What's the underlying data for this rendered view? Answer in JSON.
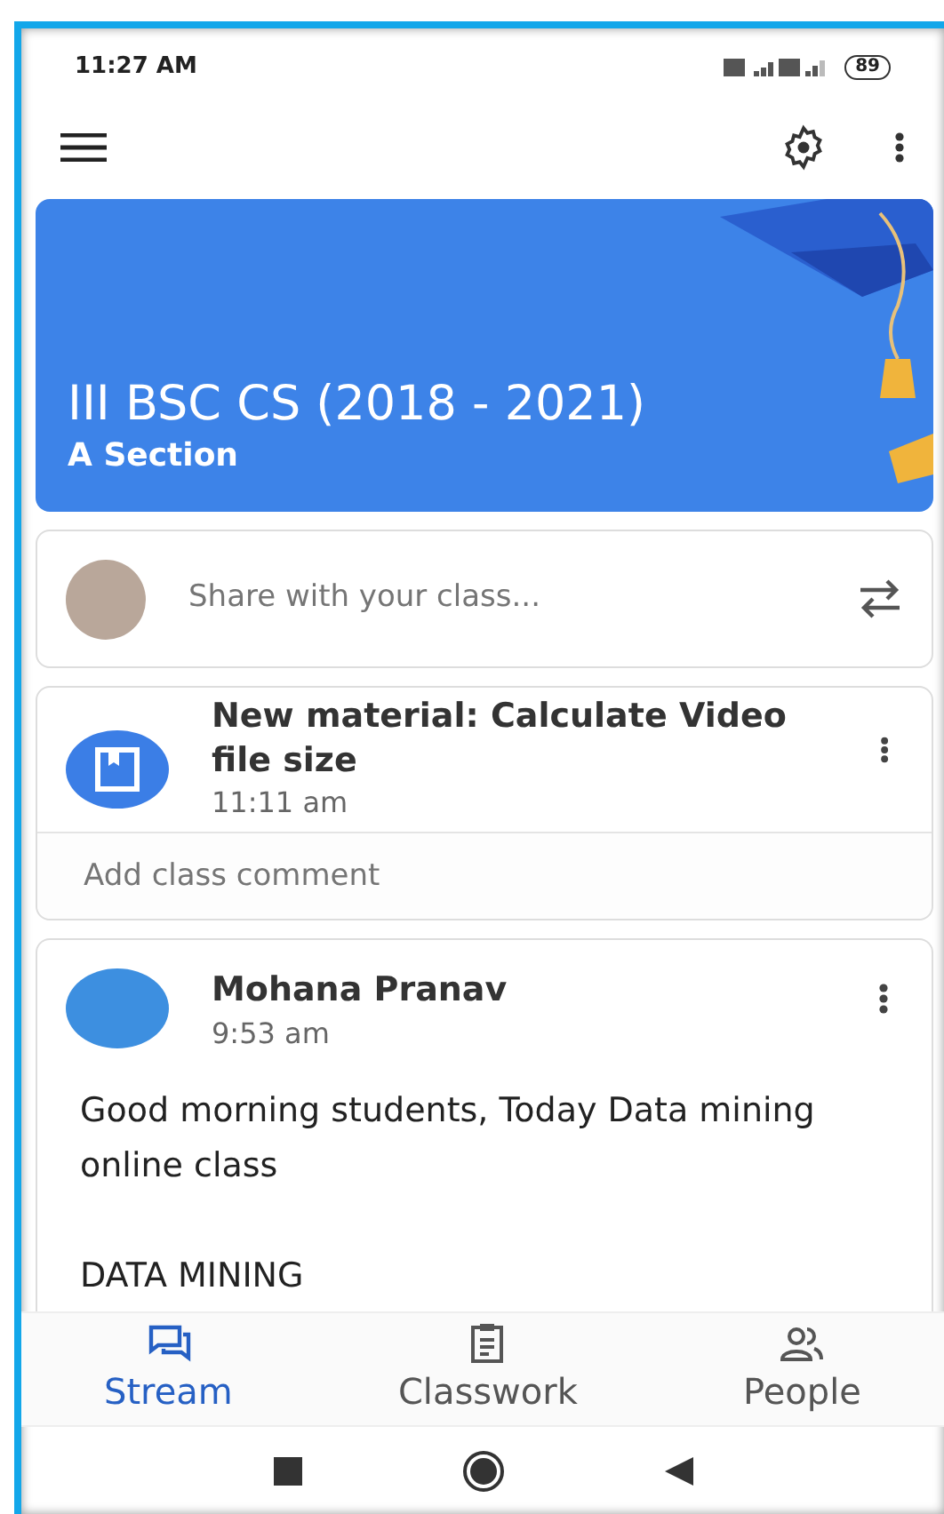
{
  "status_bar": {
    "time": "11:27 AM",
    "battery": "89"
  },
  "class_banner": {
    "title": "III BSC CS (2018 - 2021)",
    "section": "A Section"
  },
  "share_box": {
    "placeholder": "Share with your class..."
  },
  "material_post": {
    "title": "New material: Calculate Video file size",
    "time": "11:11 am",
    "comment_placeholder": "Add class comment"
  },
  "announcement": {
    "author": "Mohana Pranav",
    "time": "9:53 am",
    "paragraphs": [
      "Good morning students, Today Data mining online class",
      "DATA MINING"
    ]
  },
  "bottom_tabs": [
    {
      "kind": "stream",
      "label": "Stream",
      "selected": true
    },
    {
      "kind": "classwork",
      "label": "Classwork",
      "selected": false
    },
    {
      "kind": "people",
      "label": "People",
      "selected": false
    }
  ]
}
